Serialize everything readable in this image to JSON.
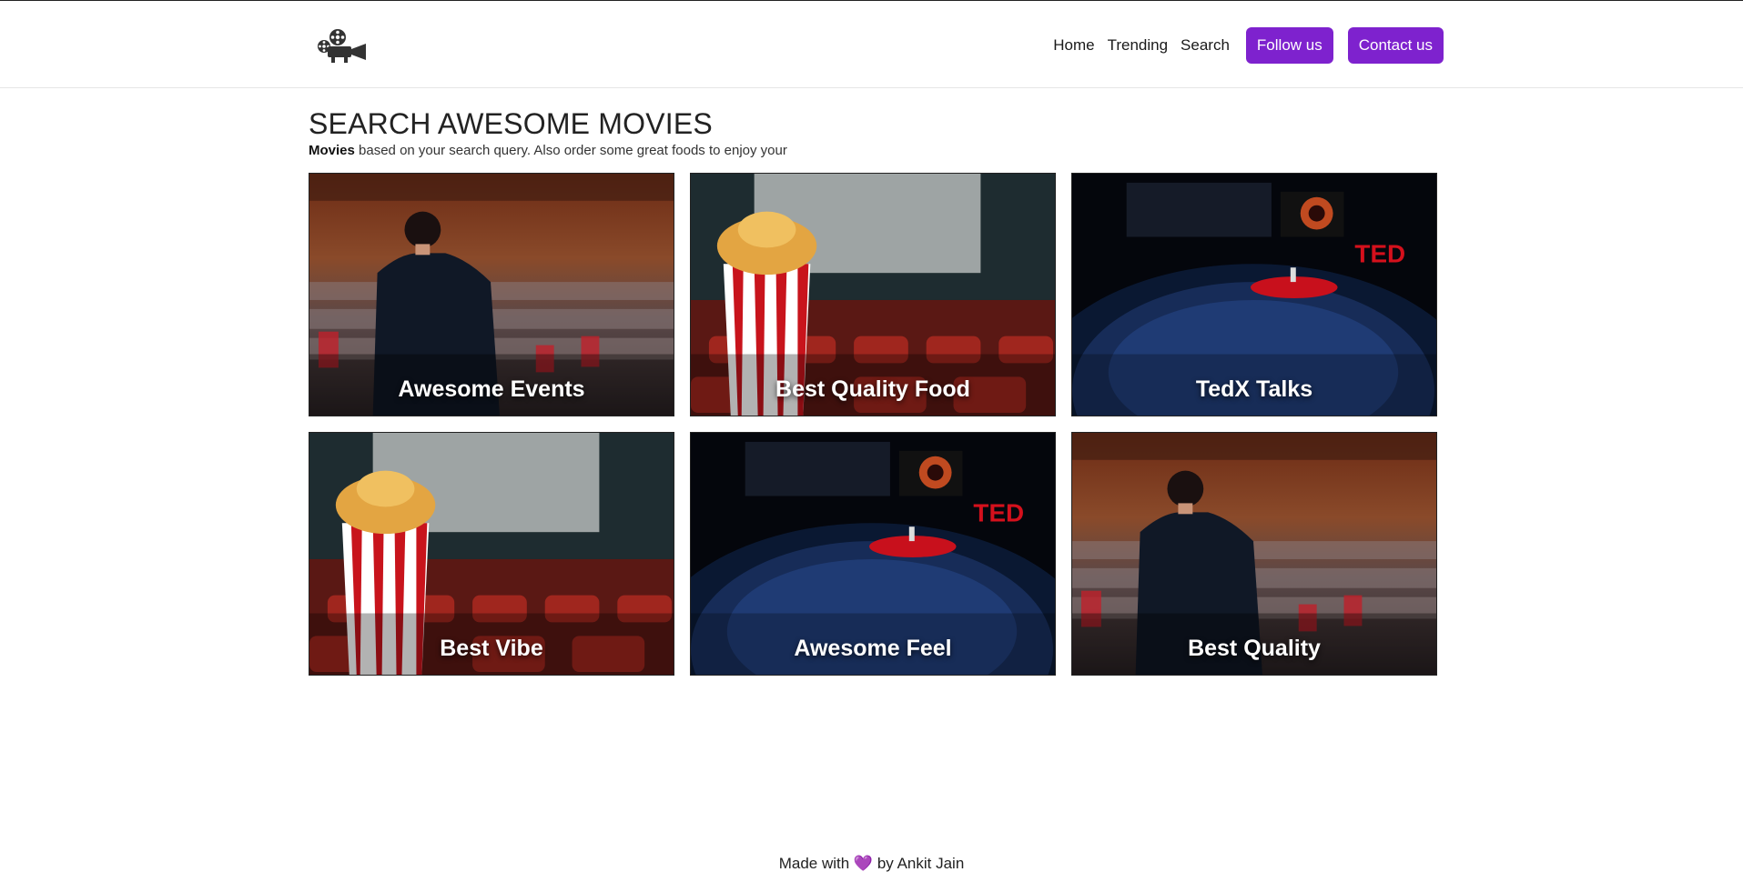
{
  "header": {
    "logo_icon": "movie-camera-icon",
    "nav": [
      {
        "label": "Home"
      },
      {
        "label": "Trending"
      },
      {
        "label": "Search"
      }
    ],
    "follow_button": "Follow us",
    "contact_button": "Contact us"
  },
  "main": {
    "title": "SEARCH AWESOME MOVIES",
    "subtitle_bold": "Movies",
    "subtitle_rest": " based on your search query. Also order some great foods to enjoy your",
    "cards": [
      {
        "title": "Awesome Events",
        "image": "speaker-audience"
      },
      {
        "title": "Best Quality Food",
        "image": "popcorn-theater"
      },
      {
        "title": "TedX Talks",
        "image": "ted-stage"
      },
      {
        "title": "Best Vibe",
        "image": "popcorn-theater"
      },
      {
        "title": "Awesome Feel",
        "image": "ted-stage"
      },
      {
        "title": "Best Quality",
        "image": "speaker-audience"
      }
    ]
  },
  "footer": {
    "prefix": "Made with",
    "heart": "💜",
    "suffix": "by Ankit Jain"
  },
  "colors": {
    "accent": "#7e22ce"
  }
}
